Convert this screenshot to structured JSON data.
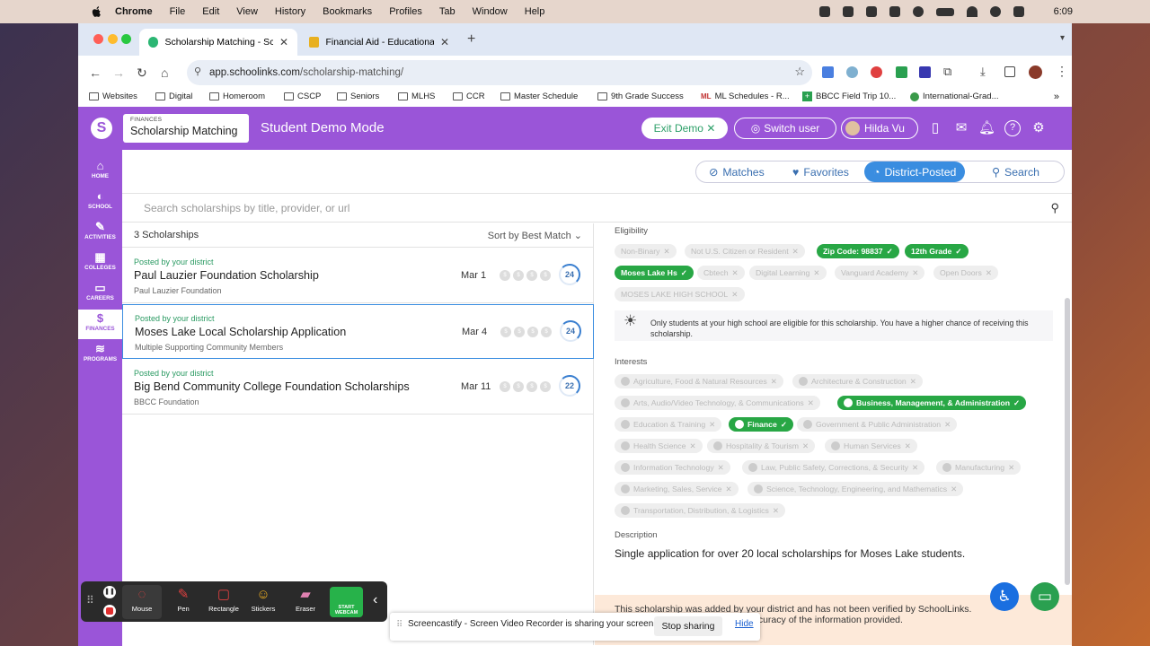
{
  "menubar": {
    "app": "Chrome",
    "items": [
      "File",
      "Edit",
      "View",
      "History",
      "Bookmarks",
      "Profiles",
      "Tab",
      "Window",
      "Help"
    ],
    "time": "6:09"
  },
  "browser": {
    "tabs": [
      {
        "label": "Scholarship Matching - Scho"
      },
      {
        "label": "Financial Aid - Educational S"
      }
    ],
    "url_domain": "app.schoolinks.com",
    "url_path": "/scholarship-matching/",
    "bookmarks": [
      "Websites",
      "Digital",
      "Homeroom",
      "CSCP",
      "Seniors",
      "MLHS",
      "CCR",
      "Master Schedule",
      "9th Grade Success",
      "ML Schedules - R...",
      "BBCC Field Trip 10...",
      "International-Grad..."
    ]
  },
  "header": {
    "module_kicker": "FINANCES",
    "module_title": "Scholarship Matching",
    "mode": "Student Demo Mode",
    "exit_demo": "Exit Demo",
    "switch_user": "Switch user",
    "user_name": "Hilda Vu"
  },
  "sidebar": {
    "items": [
      {
        "label": "HOME",
        "icon": "home-icon"
      },
      {
        "label": "SCHOOL",
        "icon": "apple-icon"
      },
      {
        "label": "ACTIVITIES",
        "icon": "palette-icon"
      },
      {
        "label": "COLLEGES",
        "icon": "building-icon"
      },
      {
        "label": "CAREERS",
        "icon": "briefcase-icon"
      },
      {
        "label": "FINANCES",
        "icon": "money-bag-icon"
      },
      {
        "label": "PROGRAMS",
        "icon": "programs-icon"
      }
    ]
  },
  "filters": {
    "matches": "Matches",
    "favorites": "Favorites",
    "district": "District-Posted",
    "search": "Search"
  },
  "search": {
    "placeholder": "Search scholarships by title, provider, or url"
  },
  "list": {
    "count": "3 Scholarships",
    "sort": "Sort by Best Match",
    "rows": [
      {
        "posted": "Posted by your district",
        "title": "Paul Lauzier Foundation Scholarship",
        "provider": "Paul Lauzier Foundation",
        "date": "Mar 1",
        "score": "24"
      },
      {
        "posted": "Posted by your district",
        "title": "Moses Lake Local Scholarship Application",
        "provider": "Multiple Supporting Community Members",
        "date": "Mar 4",
        "score": "24"
      },
      {
        "posted": "Posted by your district",
        "title": "Big Bend Community College Foundation Scholarships",
        "provider": "BBCC Foundation",
        "date": "Mar 11",
        "score": "22"
      }
    ]
  },
  "detail": {
    "eligibility_label": "Eligibility",
    "eligibility": [
      "Non-Binary",
      "Not U.S. Citizen or Resident",
      "Zip Code: 98837",
      "12th Grade",
      "Moses Lake Hs",
      "Cbtech",
      "Digital Learning",
      "Vanguard Academy",
      "Open Doors",
      "MOSES LAKE HIGH SCHOOL"
    ],
    "note": "Only students at your high school are eligible for this scholarship. You have a higher chance of receiving this scholarship.",
    "interests_label": "Interests",
    "interests": [
      "Agriculture, Food & Natural Resources",
      "Architecture & Construction",
      "Arts, Audio/Video Technology, & Communications",
      "Business, Management, & Administration",
      "Education & Training",
      "Finance",
      "Government & Public Administration",
      "Health Science",
      "Hospitality & Tourism",
      "Human Services",
      "Information Technology",
      "Law, Public Safety, Corrections, & Security",
      "Manufacturing",
      "Marketing, Sales, Service",
      "Science, Technology, Engineering, and Mathematics",
      "Transportation, Distribution, & Logistics"
    ],
    "description_label": "Description",
    "description": "Single application for over 20 local scholarships for Moses Lake students.",
    "disclaimer1": "This scholarship was added by your district and has not been verified by SchoolLinks.",
    "disclaimer2": "e accuracy of the information provided."
  },
  "recorder": {
    "tools": [
      "Mouse",
      "Pen",
      "Rectangle",
      "Stickers",
      "Eraser"
    ],
    "webcam": "START WEBCAM"
  },
  "share": {
    "message": "Screencastify - Screen Video Recorder is sharing your screen.",
    "stop": "Stop sharing",
    "hide": "Hide"
  },
  "colors": {
    "brand": "#9a55d8",
    "accent": "#3a8de0",
    "selected_chip": "#28a745"
  }
}
